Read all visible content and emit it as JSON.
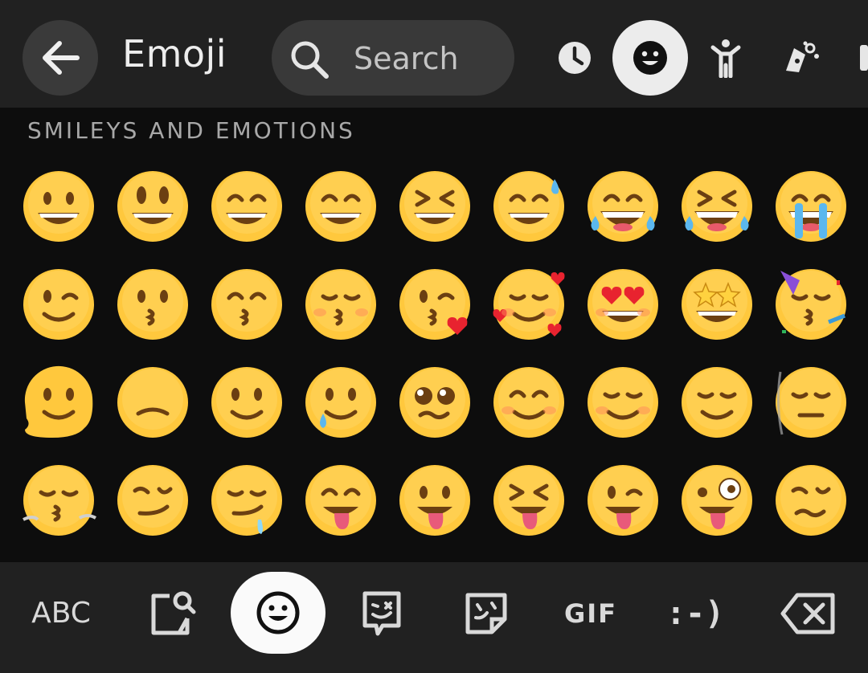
{
  "header": {
    "title": "Emoji",
    "search_placeholder": "Search",
    "tabs": [
      {
        "icon": "recent-icon"
      },
      {
        "icon": "smiley-icon",
        "active": true
      },
      {
        "icon": "person-icon"
      },
      {
        "icon": "animal-icon"
      },
      {
        "icon": "food-icon"
      }
    ]
  },
  "section": {
    "title": "SMILEYS AND EMOTIONS",
    "emojis": [
      "grinning-face",
      "grinning-face-with-big-eyes",
      "grinning-face-with-smiling-eyes",
      "beaming-face",
      "grinning-squinting-face",
      "grinning-face-with-sweat",
      "face-with-tears-of-joy",
      "rolling-on-the-floor-laughing",
      "loudly-crying-face",
      "winking-face",
      "kissing-face",
      "kissing-face-with-smiling-eyes",
      "kissing-face-with-closed-eyes",
      "face-blowing-a-kiss",
      "smiling-face-with-hearts",
      "smiling-face-with-heart-eyes",
      "star-struck",
      "partying-face",
      "melting-face",
      "upside-down-face",
      "slightly-smiling-face",
      "face-holding-back-tears",
      "pleading-face",
      "smiling-face-with-smiling-eyes",
      "smiling-face",
      "relieved-face",
      "face-in-clouds",
      "face-exhaling",
      "smirking-face",
      "drooling-face",
      "face-savoring-food",
      "face-with-tongue",
      "squinting-face-with-tongue",
      "winking-face-with-tongue",
      "zany-face",
      "woozy-face"
    ]
  },
  "bottom": {
    "abc_label": "ABC",
    "gif_label": "GIF",
    "emoticon_label": ":-)",
    "items": [
      {
        "icon": "abc"
      },
      {
        "icon": "sticker-search-icon"
      },
      {
        "icon": "emoji-icon",
        "active": true
      },
      {
        "icon": "bitmoji-icon"
      },
      {
        "icon": "sticker-icon"
      },
      {
        "icon": "gif"
      },
      {
        "icon": "emoticon"
      },
      {
        "icon": "backspace-icon"
      }
    ]
  },
  "colors": {
    "background": "#0d0d0d",
    "bar": "#212121",
    "button": "#393939",
    "active_tab": "#ececec",
    "emoji_yellow": "#FFC83D"
  }
}
